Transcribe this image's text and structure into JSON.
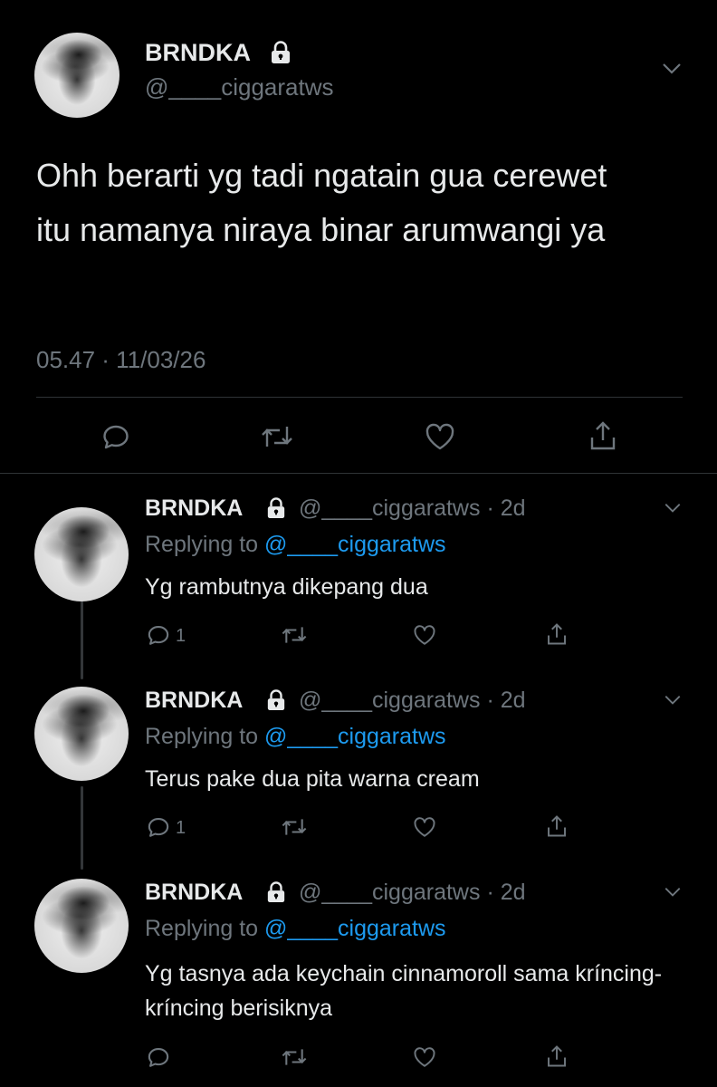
{
  "main_tweet": {
    "display_name": "BRNDKA",
    "handle": "@____ciggaratws",
    "text": "Ohh berarti yg tadi ngatain gua cerewet itu namanya niraya binar arumwangi ya",
    "timestamp": "05.47 · 11/03/26"
  },
  "replies": [
    {
      "display_name": "BRNDKA",
      "handle": "@____ciggaratws",
      "sep": "·",
      "time": "2d",
      "replying_prefix": "Replying to",
      "replying_handle": "@____ciggaratws",
      "text": "Yg rambutnya dikepang dua",
      "reply_count": "1"
    },
    {
      "display_name": "BRNDKA",
      "handle": "@____ciggaratws",
      "sep": "·",
      "time": "2d",
      "replying_prefix": "Replying to",
      "replying_handle": "@____ciggaratws",
      "text": "Terus pake dua pita warna cream",
      "reply_count": "1"
    },
    {
      "display_name": "BRNDKA",
      "handle": "@____ciggaratws",
      "sep": "·",
      "time": "2d",
      "replying_prefix": "Replying to",
      "replying_handle": "@____ciggaratws",
      "text": "Yg tasnya ada keychain cinnamoroll sama kríncing-kríncing berisiknya",
      "reply_count": ""
    }
  ],
  "icons": [
    "lock-icon",
    "chevron-down-icon",
    "reply-icon",
    "retweet-icon",
    "like-icon",
    "share-icon"
  ],
  "colors": {
    "background": "#000000",
    "text": "#e7e9ea",
    "secondary": "#6e767d",
    "link": "#1d9bf0",
    "divider": "#2f3336"
  }
}
